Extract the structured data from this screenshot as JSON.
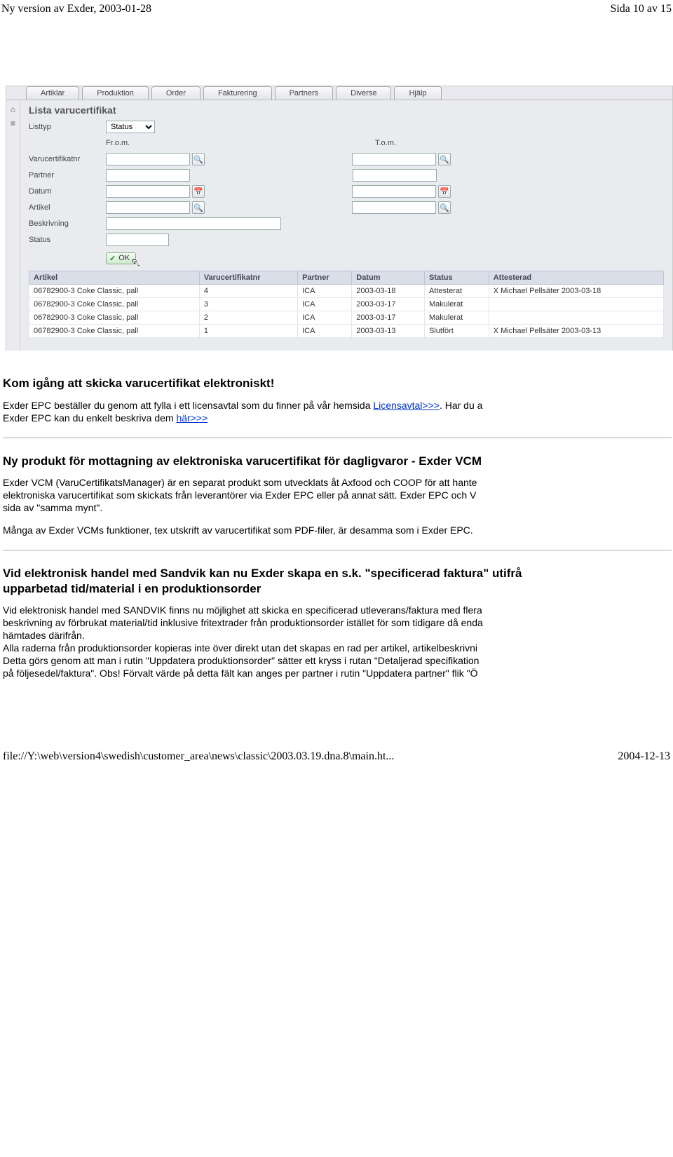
{
  "header": {
    "left": "Ny version av Exder, 2003-01-28",
    "right": "Sida 10 av 15"
  },
  "app": {
    "tabs": [
      "Artiklar",
      "Produktion",
      "Order",
      "Fakturering",
      "Partners",
      "Diverse",
      "Hjälp"
    ],
    "title": "Lista varucertifikat",
    "form": {
      "listtyp_label": "Listtyp",
      "listtyp_value": "Status",
      "from_label": "Fr.o.m.",
      "to_label": "T.o.m.",
      "varucert_label": "Varucertifikatnr",
      "partner_label": "Partner",
      "datum_label": "Datum",
      "artikel_label": "Artikel",
      "beskrivning_label": "Beskrivning",
      "status_label": "Status",
      "ok_label": "OK"
    },
    "grid": {
      "headers": [
        "Artikel",
        "Varucertifikatnr",
        "Partner",
        "Datum",
        "Status",
        "Attesterad"
      ],
      "rows": [
        {
          "artikel": "06782900-3 Coke Classic, pall",
          "vc": "4",
          "partner": "ICA",
          "datum": "2003-03-18",
          "status": "Attesterat",
          "att": "X Michael Pellsäter 2003-03-18"
        },
        {
          "artikel": "06782900-3 Coke Classic, pall",
          "vc": "3",
          "partner": "ICA",
          "datum": "2003-03-17",
          "status": "Makulerat",
          "att": ""
        },
        {
          "artikel": "06782900-3 Coke Classic, pall",
          "vc": "2",
          "partner": "ICA",
          "datum": "2003-03-17",
          "status": "Makulerat",
          "att": ""
        },
        {
          "artikel": "06782900-3 Coke Classic, pall",
          "vc": "1",
          "partner": "ICA",
          "datum": "2003-03-13",
          "status": "Slutfört",
          "att": "X Michael Pellsäter 2003-03-13"
        }
      ]
    }
  },
  "sec1": {
    "title": "Kom igång att skicka varucertifikat elektroniskt!",
    "p1a": "Exder EPC beställer du genom att fylla i ett licensavtal som du finner på vår hemsida ",
    "p1link": "Licensavtal>>>",
    "p1b": ". Har du a",
    "p2a": "Exder EPC kan du enkelt beskriva dem ",
    "p2link": "här>>>"
  },
  "sec2": {
    "title": "Ny produkt för mottagning av elektroniska varucertifikat för dagligvaror - Exder VCM",
    "p1": "Exder VCM (VaruCertifikatsManager) är en separat produkt som utvecklats åt Axfood och COOP för att hante",
    "p2": "elektroniska varucertifikat som skickats från leverantörer via Exder EPC eller på annat sätt. Exder EPC och V",
    "p3": "sida av \"samma mynt\".",
    "p4": "Många av Exder VCMs funktioner, tex utskrift av varucertifikat som PDF-filer, är desamma som i Exder EPC."
  },
  "sec3": {
    "title": "Vid elektronisk handel med Sandvik kan nu Exder skapa en s.k. \"specificerad faktura\" utifrå",
    "title2": "upparbetad tid/material i en produktionsorder",
    "p1": "Vid elektronisk handel med SANDVIK finns nu möjlighet att skicka en specificerad utleverans/faktura med flera",
    "p2": "beskrivning av förbrukat material/tid inklusive fritextrader från produktionsorder istället för som tidigare då enda",
    "p3": "hämtades därifrån.",
    "p4": "Alla raderna från produktionsorder kopieras inte över direkt utan det skapas en rad per artikel, artikelbeskrivni",
    "p5": "Detta görs genom att man i rutin \"Uppdatera produktionsorder\" sätter ett kryss i rutan \"Detaljerad specifikation",
    "p6": "på följesedel/faktura\". Obs! Förvalt värde på detta fält kan anges per partner i rutin \"Uppdatera partner\" flik \"Ö"
  },
  "footer": {
    "left": "file://Y:\\web\\version4\\swedish\\customer_area\\news\\classic\\2003.03.19.dna.8\\main.ht...",
    "right": "2004-12-13"
  }
}
